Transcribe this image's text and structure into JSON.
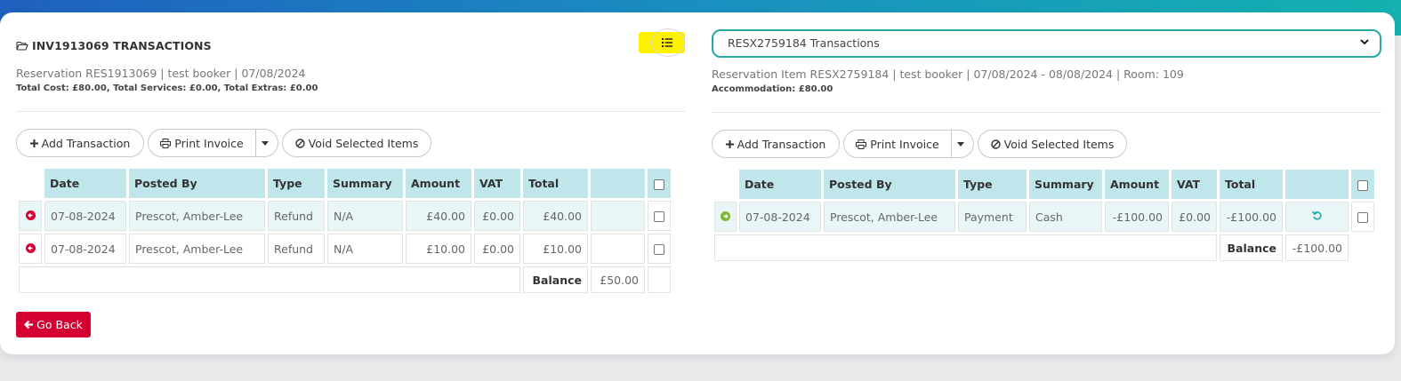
{
  "left": {
    "title": "INV1913069 TRANSACTIONS",
    "subtitle": "Reservation RES1913069 | test booker | 07/08/2024",
    "totals": "Total Cost: £80.00, Total Services: £0.00, Total Extras: £0.00",
    "buttons": {
      "add": "Add Transaction",
      "print": "Print Invoice",
      "void": "Void Selected Items"
    },
    "headers": [
      "Date",
      "Posted By",
      "Type",
      "Summary",
      "Amount",
      "VAT",
      "Total"
    ],
    "rows": [
      {
        "date": "07-08-2024",
        "posted_by": "Prescot, Amber-Lee",
        "type": "Refund",
        "summary": "N/A",
        "amount": "£40.00",
        "vat": "£0.00",
        "total": "£40.00"
      },
      {
        "date": "07-08-2024",
        "posted_by": "Prescot, Amber-Lee",
        "type": "Refund",
        "summary": "N/A",
        "amount": "£10.00",
        "vat": "£0.00",
        "total": "£10.00"
      }
    ],
    "balance_label": "Balance",
    "balance_value": "£50.00",
    "go_back": "Go Back"
  },
  "right": {
    "select_value": "RESX2759184 Transactions",
    "subtitle": "Reservation Item RESX2759184 | test booker | 07/08/2024 - 08/08/2024 | Room: 109",
    "totals": "Accommodation: £80.00",
    "buttons": {
      "add": "Add Transaction",
      "print": "Print Invoice",
      "void": "Void Selected Items"
    },
    "headers": [
      "Date",
      "Posted By",
      "Type",
      "Summary",
      "Amount",
      "VAT",
      "Total"
    ],
    "rows": [
      {
        "date": "07-08-2024",
        "posted_by": "Prescot, Amber-Lee",
        "type": "Payment",
        "summary": "Cash",
        "amount": "-£100.00",
        "vat": "£0.00",
        "total": "-£100.00"
      }
    ],
    "balance_label": "Balance",
    "balance_value": "-£100.00"
  },
  "colors": {
    "header_bg": "#bfe6ea",
    "refund_icon": "#d50032",
    "payment_icon": "#7cb82f",
    "accent": "#25a8a8",
    "highlight": "#fff200"
  },
  "icons": [
    "folder-open-icon",
    "list-icon",
    "plus-icon",
    "print-icon",
    "caret-down-icon",
    "ban-icon",
    "arrow-circle-left-icon",
    "arrow-circle-right-icon",
    "undo-icon",
    "arrow-left-icon"
  ]
}
